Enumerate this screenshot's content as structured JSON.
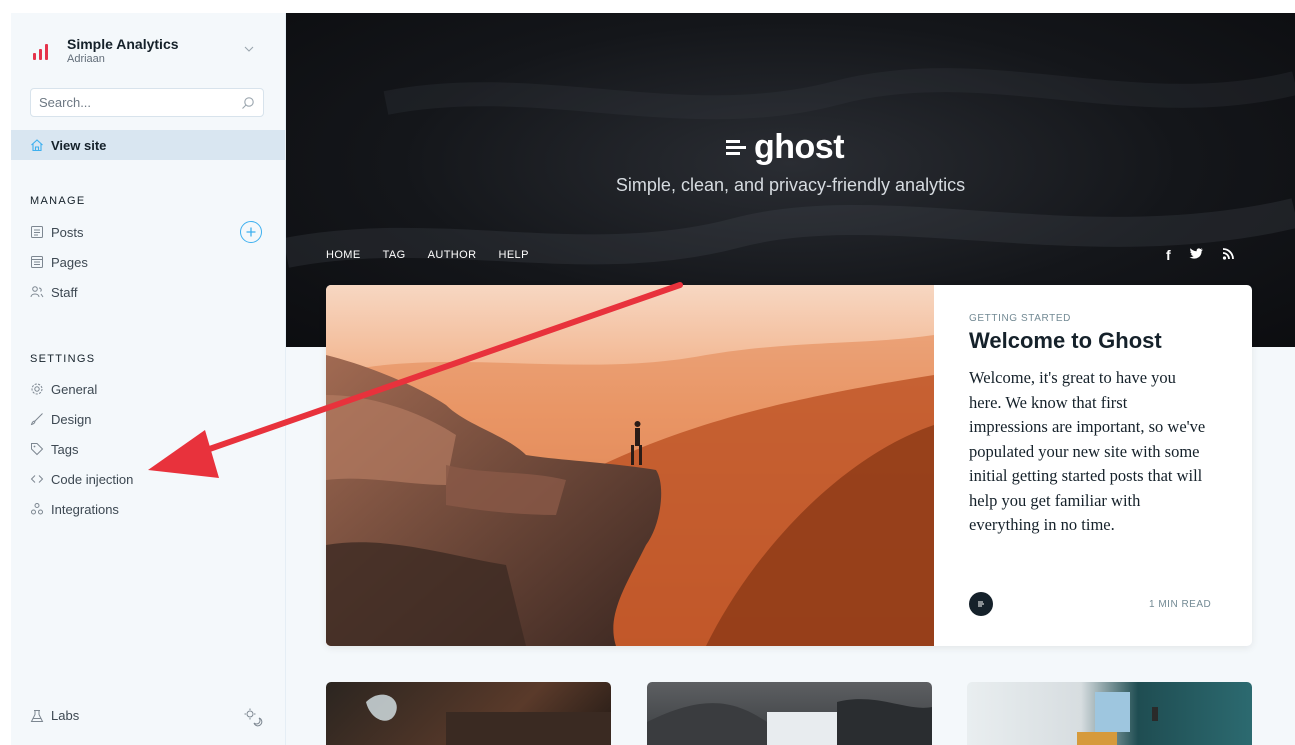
{
  "brand": {
    "title": "Simple Analytics",
    "user": "Adriaan"
  },
  "search": {
    "placeholder": "Search..."
  },
  "sidebar": {
    "view_site": "View site",
    "manage_label": "MANAGE",
    "manage_items": [
      {
        "label": "Posts",
        "icon": "posts-icon"
      },
      {
        "label": "Pages",
        "icon": "pages-icon"
      },
      {
        "label": "Staff",
        "icon": "staff-icon"
      }
    ],
    "settings_label": "SETTINGS",
    "settings_items": [
      {
        "label": "General",
        "icon": "gear-icon"
      },
      {
        "label": "Design",
        "icon": "brush-icon"
      },
      {
        "label": "Tags",
        "icon": "tag-icon"
      },
      {
        "label": "Code injection",
        "icon": "code-icon"
      },
      {
        "label": "Integrations",
        "icon": "integrations-icon"
      }
    ],
    "labs": "Labs"
  },
  "site": {
    "logo_text": "ghost",
    "tagline": "Simple, clean, and privacy-friendly analytics",
    "nav": [
      "HOME",
      "TAG",
      "AUTHOR",
      "HELP"
    ],
    "socials": [
      "f",
      "twitter",
      "rss"
    ]
  },
  "featured_post": {
    "tag": "GETTING STARTED",
    "title": "Welcome to Ghost",
    "excerpt": "Welcome, it's great to have you here. We know that first impressions are important, so we've populated your new site with some initial getting started posts that will help you get familiar with everything in no time.",
    "read_time": "1 MIN READ"
  },
  "colors": {
    "accent": "#3eb0ef",
    "brand": "#e5334b",
    "annotation_arrow": "#e8323c"
  }
}
